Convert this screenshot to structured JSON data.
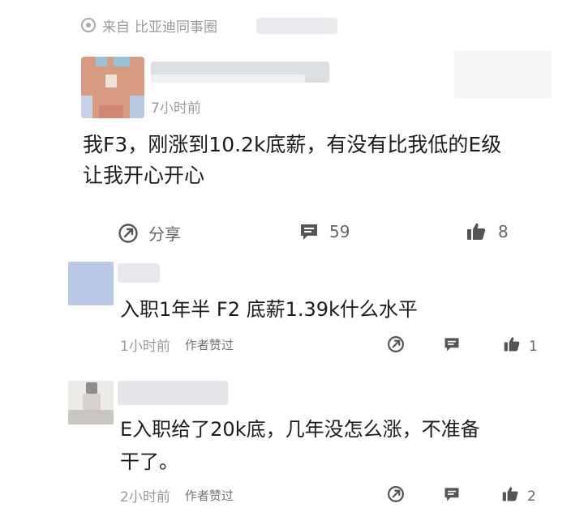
{
  "source": {
    "prefix": "来自",
    "circle_name": "比亚迪同事圈",
    "icon": "target-icon"
  },
  "post": {
    "time": "7小时前",
    "text_line1": "我F3，刚涨到10.2k底薪，有没有比我低的E级",
    "text_line2": "让我开心开心",
    "actions": {
      "share_label": "分享",
      "comment_count": "59",
      "like_count": "8"
    }
  },
  "replies": [
    {
      "text": "入职1年半 F2 底薪1.39k什么水平",
      "time": "1小时前",
      "badge": "作者赞过",
      "like_count": "1"
    },
    {
      "text_line1": "E入职给了20k底，几年没怎么涨，不准备",
      "text_line2": "干了。",
      "time": "2小时前",
      "badge": "作者赞过",
      "like_count": "2"
    }
  ],
  "colors": {
    "text": "#1c1c1c",
    "muted": "#9a9a9a",
    "icon": "#666666"
  }
}
